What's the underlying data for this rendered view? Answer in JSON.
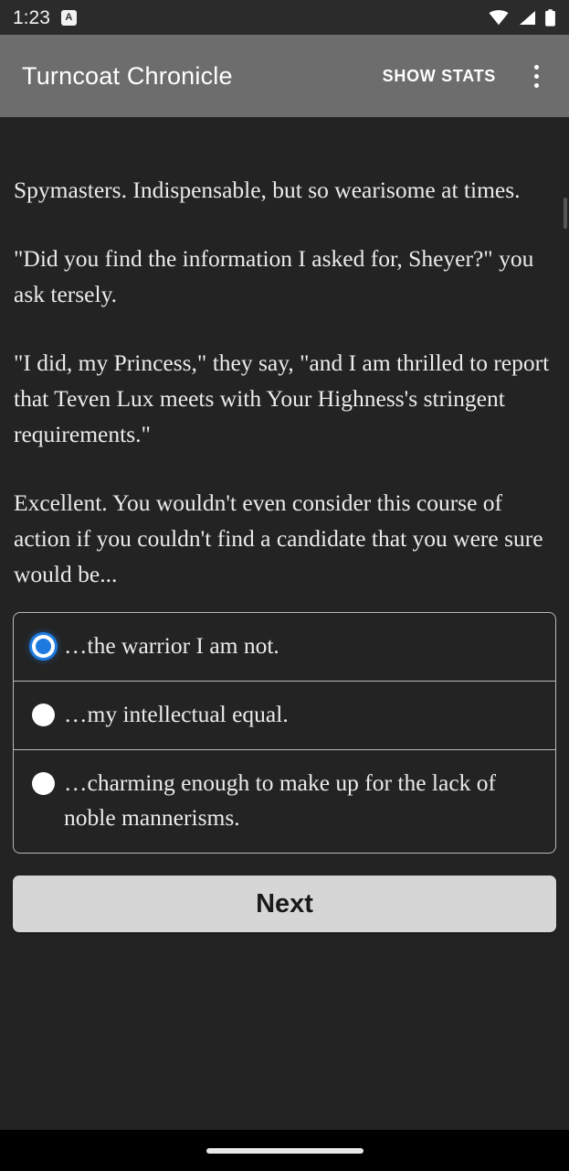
{
  "status_bar": {
    "clock": "1:23",
    "badge_label": "A",
    "icons": [
      "wifi-icon",
      "cell-signal-icon",
      "battery-icon"
    ]
  },
  "app_bar": {
    "title": "Turncoat Chronicle",
    "show_stats_label": "SHOW STATS",
    "overflow_icon": "overflow-menu-icon",
    "background_color": "#6d6d6d"
  },
  "story": {
    "paragraphs": [
      "Spymasters. Indispensable, but so wearisome at times.",
      "\"Did you find the information I asked for, Sheyer?\" you ask tersely.",
      "\"I did, my Princess,\" they say, \"and I am thrilled to report that Teven Lux meets with Your Highness's stringent requirements.\"",
      "Excellent. You wouldn't even consider this course of action if you couldn't find a candidate that you were sure would be..."
    ]
  },
  "choices": {
    "selected_index": 0,
    "selected_color": "#1f7ae0",
    "items": [
      {
        "label": "…the warrior I am not.",
        "selected": true
      },
      {
        "label": "…my intellectual equal.",
        "selected": false
      },
      {
        "label": "…charming enough to make up for the lack of noble mannerisms.",
        "selected": false
      }
    ]
  },
  "actions": {
    "next_label": "Next"
  },
  "nav_bar": {
    "gesture_pill": "home-gesture-pill"
  }
}
